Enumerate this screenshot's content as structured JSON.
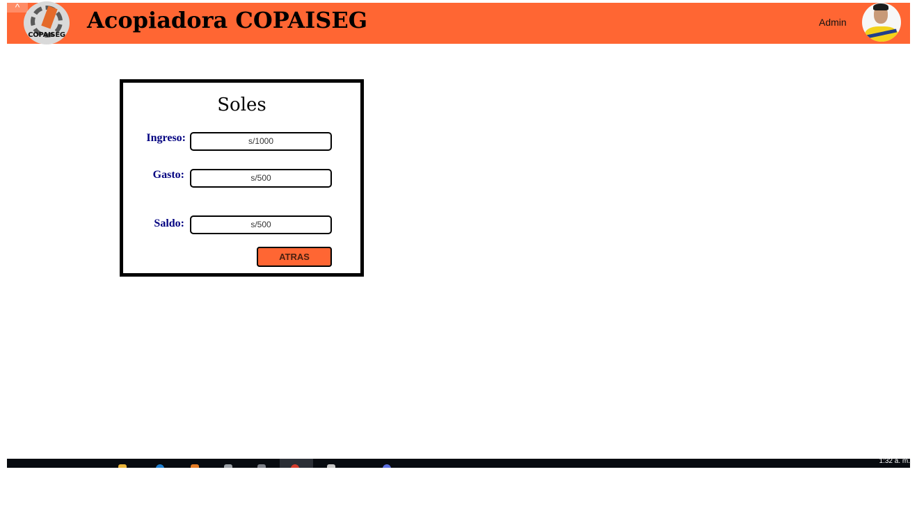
{
  "header": {
    "logo_text": "COPAISEG",
    "title": "Acopiadora COPAISEG",
    "user_name": "Admin",
    "caret_icon": "^"
  },
  "panel": {
    "title": "Soles",
    "fields": [
      {
        "label": "Ingreso:",
        "value": "s/1000"
      },
      {
        "label": "Gasto:",
        "value": "s/500"
      },
      {
        "label": "Saldo:",
        "value": "s/500"
      }
    ],
    "back_button": "ATRAS"
  },
  "taskbar": {
    "clock": "1:32 a. m."
  },
  "colors": {
    "accent": "#ff6633",
    "label": "#000080"
  }
}
